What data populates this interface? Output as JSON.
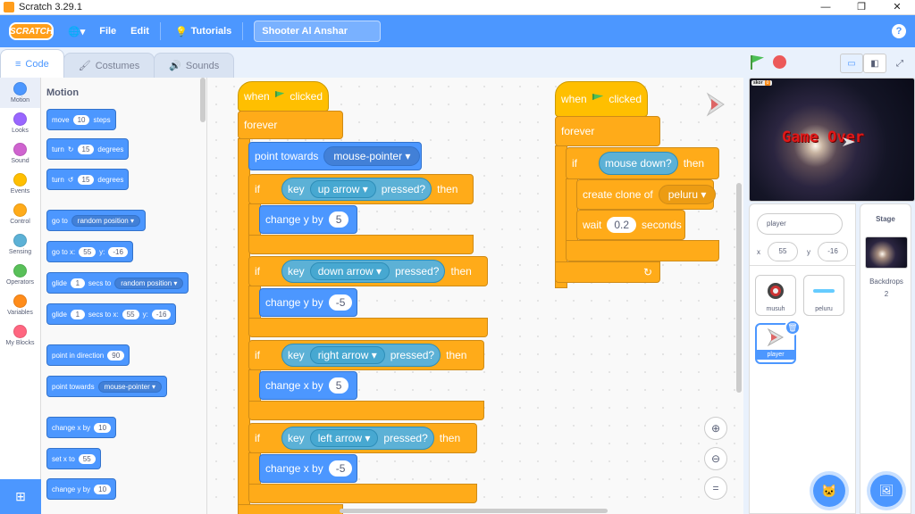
{
  "window": {
    "title": "Scratch 3.29.1",
    "minimize": "—",
    "maximize": "❐",
    "close": "✕"
  },
  "menu": {
    "logo": "SCRATCH",
    "globe": "🌐▾",
    "file": "File",
    "edit": "Edit",
    "tutorials": "Tutorials",
    "project_title": "Shooter Al Anshar",
    "help": "?"
  },
  "tabs": [
    {
      "label": "Code",
      "icon": "≡"
    },
    {
      "label": "Costumes",
      "icon": "🖌"
    },
    {
      "label": "Sounds",
      "icon": "🔊"
    }
  ],
  "categories": [
    {
      "label": "Motion",
      "color": "#4c97ff"
    },
    {
      "label": "Looks",
      "color": "#9966ff"
    },
    {
      "label": "Sound",
      "color": "#cf63cf"
    },
    {
      "label": "Events",
      "color": "#ffbf00"
    },
    {
      "label": "Control",
      "color": "#ffab19"
    },
    {
      "label": "Sensing",
      "color": "#5cb1d6"
    },
    {
      "label": "Operators",
      "color": "#59c059"
    },
    {
      "label": "Variables",
      "color": "#ff8c1a"
    },
    {
      "label": "My Blocks",
      "color": "#ff6680"
    }
  ],
  "palette": {
    "heading": "Motion",
    "move": {
      "a": "move",
      "v": "10",
      "b": "steps"
    },
    "turn_r": {
      "a": "turn",
      "icon": "↻",
      "v": "15",
      "b": "degrees"
    },
    "turn_l": {
      "a": "turn",
      "icon": "↺",
      "v": "15",
      "b": "degrees"
    },
    "goto": {
      "a": "go to",
      "dd": "random position ▾"
    },
    "gotoxy": {
      "a": "go to x:",
      "x": "55",
      "b": "y:",
      "y": "-16"
    },
    "glide1": {
      "a": "glide",
      "v": "1",
      "b": "secs to",
      "dd": "random position ▾"
    },
    "glide2": {
      "a": "glide",
      "v": "1",
      "b": "secs to x:",
      "x": "55",
      "c": "y:",
      "y": "-16"
    },
    "pointdir": {
      "a": "point in direction",
      "v": "90"
    },
    "pointtow": {
      "a": "point towards",
      "dd": "mouse-pointer ▾"
    },
    "changex": {
      "a": "change x by",
      "v": "10"
    },
    "setx": {
      "a": "set x to",
      "v": "55"
    },
    "changey": {
      "a": "change y by",
      "v": "10"
    }
  },
  "script1": {
    "when": "when",
    "clicked": "clicked",
    "forever": "forever",
    "point": "point towards",
    "point_dd": "mouse-pointer ▾",
    "if_word": "if",
    "then_word": "then",
    "key_word": "key",
    "pressed": "pressed?",
    "change_y": "change y by",
    "change_x": "change x by",
    "k1": "up arrow ▾",
    "v1": "5",
    "k2": "down arrow ▾",
    "v2": "-5",
    "k3": "right arrow ▾",
    "v3": "5",
    "k4": "left arrow ▾",
    "v4": "-5"
  },
  "script2": {
    "when": "when",
    "clicked": "clicked",
    "forever": "forever",
    "if_word": "if",
    "then_word": "then",
    "cond": "mouse down?",
    "create": "create clone of",
    "create_dd": "peluru ▾",
    "wait": "wait",
    "wait_v": "0.2",
    "seconds": "seconds",
    "loop_arrow": "↻"
  },
  "zoom": {
    "in": "⊕",
    "out": "⊖",
    "reset": "="
  },
  "stage": {
    "game_over": "Game Over",
    "var_name": "skor",
    "var_value": "0"
  },
  "sprite_info": {
    "name": "player",
    "x_label": "x",
    "x": "55",
    "y_label": "y",
    "y": "-16"
  },
  "sprites": [
    {
      "name": "musuh"
    },
    {
      "name": "peluru"
    },
    {
      "name": "player"
    }
  ],
  "stage_panel": {
    "title": "Stage",
    "backdrops_label": "Backdrops",
    "backdrops_count": "2"
  },
  "icons": {
    "delete": "🗑",
    "add_sprite": "🐱",
    "add_backdrop": "🖼",
    "extension": "⊞"
  }
}
